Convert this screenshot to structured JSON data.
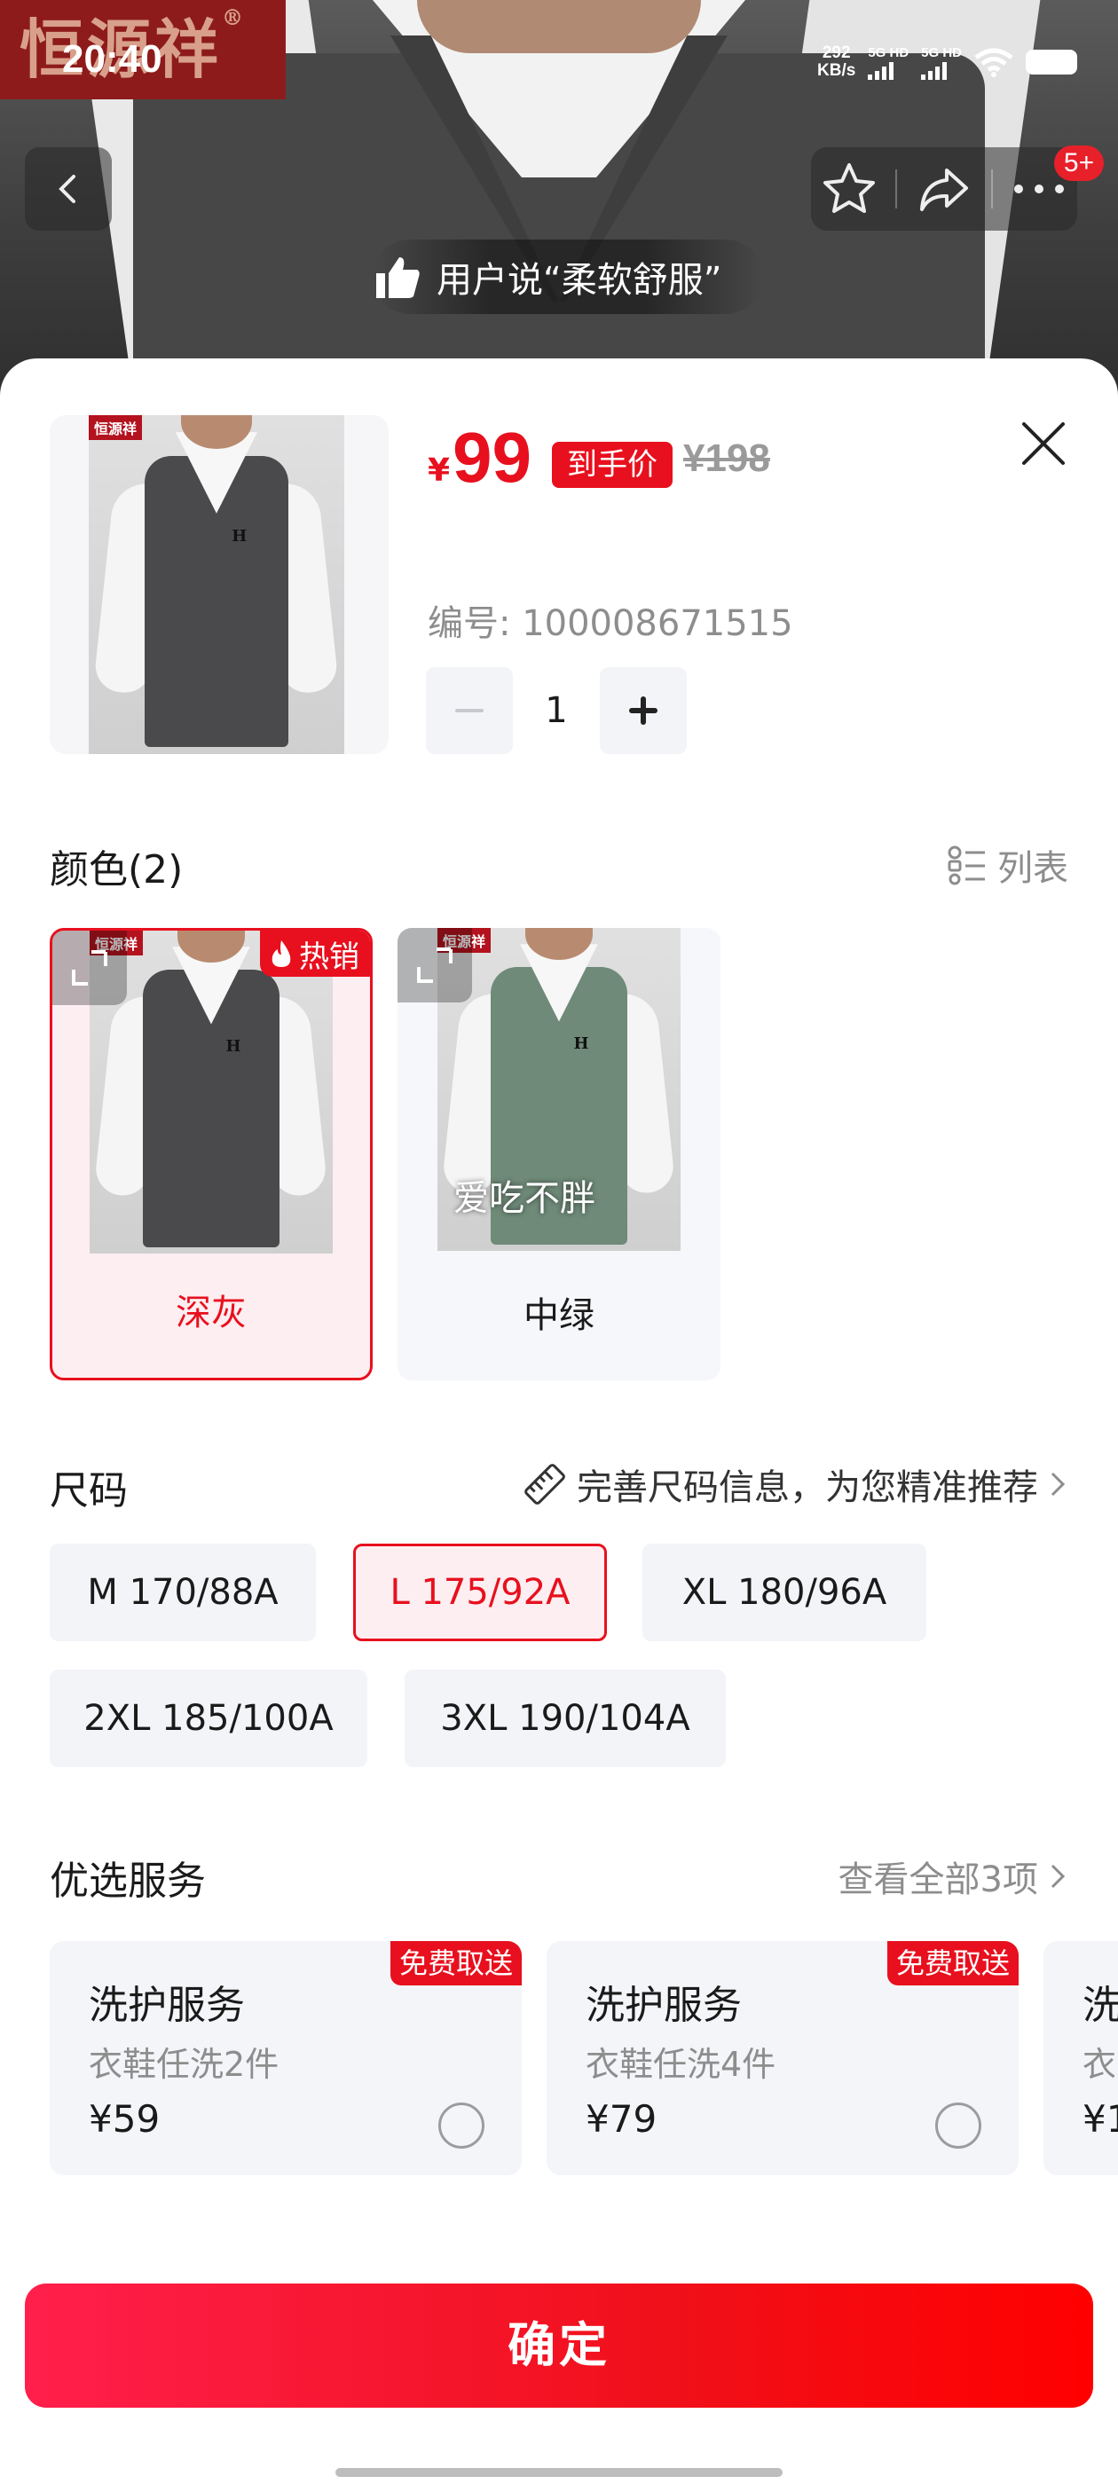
{
  "status": {
    "time": "20:40",
    "speed_value": "292",
    "speed_unit": "KB/s",
    "sim1": "5G HD",
    "sim2": "5G HD"
  },
  "brand": {
    "name": "恒源祥",
    "mark": "®",
    "mini": "恒源祥"
  },
  "nav": {
    "badge": "5+"
  },
  "banner": {
    "text": "用户说“柔软舒服”"
  },
  "product": {
    "currency": "¥",
    "price": "99",
    "price_tag": "到手价",
    "old_price": "¥198",
    "sku_label": "编号: 100008671515",
    "quantity": "1"
  },
  "color_section": {
    "title": "颜色(2)",
    "view_toggle": "列表",
    "options": [
      {
        "label": "深灰",
        "tag": "热销",
        "selected": true,
        "swatch": "#4a4a4c"
      },
      {
        "label": "中绿",
        "overlay": "爱吃不胖",
        "selected": false,
        "swatch": "#6f8a78"
      }
    ]
  },
  "size_section": {
    "title": "尺码",
    "hint": "完善尺码信息，为您精准推荐",
    "options": [
      "M 170/88A",
      "L 175/92A",
      "XL 180/96A",
      "2XL 185/100A",
      "3XL 190/104A"
    ],
    "selected": "L 175/92A"
  },
  "service_section": {
    "title": "优选服务",
    "view_all": "查看全部3项",
    "items": [
      {
        "title": "洗护服务",
        "desc": "衣鞋任洗2件",
        "price": "¥59",
        "ribbon": "免费取送"
      },
      {
        "title": "洗护服务",
        "desc": "衣鞋任洗4件",
        "price": "¥79",
        "ribbon": "免费取送"
      },
      {
        "title": "洗",
        "desc": "衣",
        "price": "¥1"
      }
    ]
  },
  "confirm": {
    "label": "确定"
  },
  "colors": {
    "accent": "#e8101e",
    "muted": "#8d8d8d",
    "chip_bg": "#f3f4f8"
  }
}
